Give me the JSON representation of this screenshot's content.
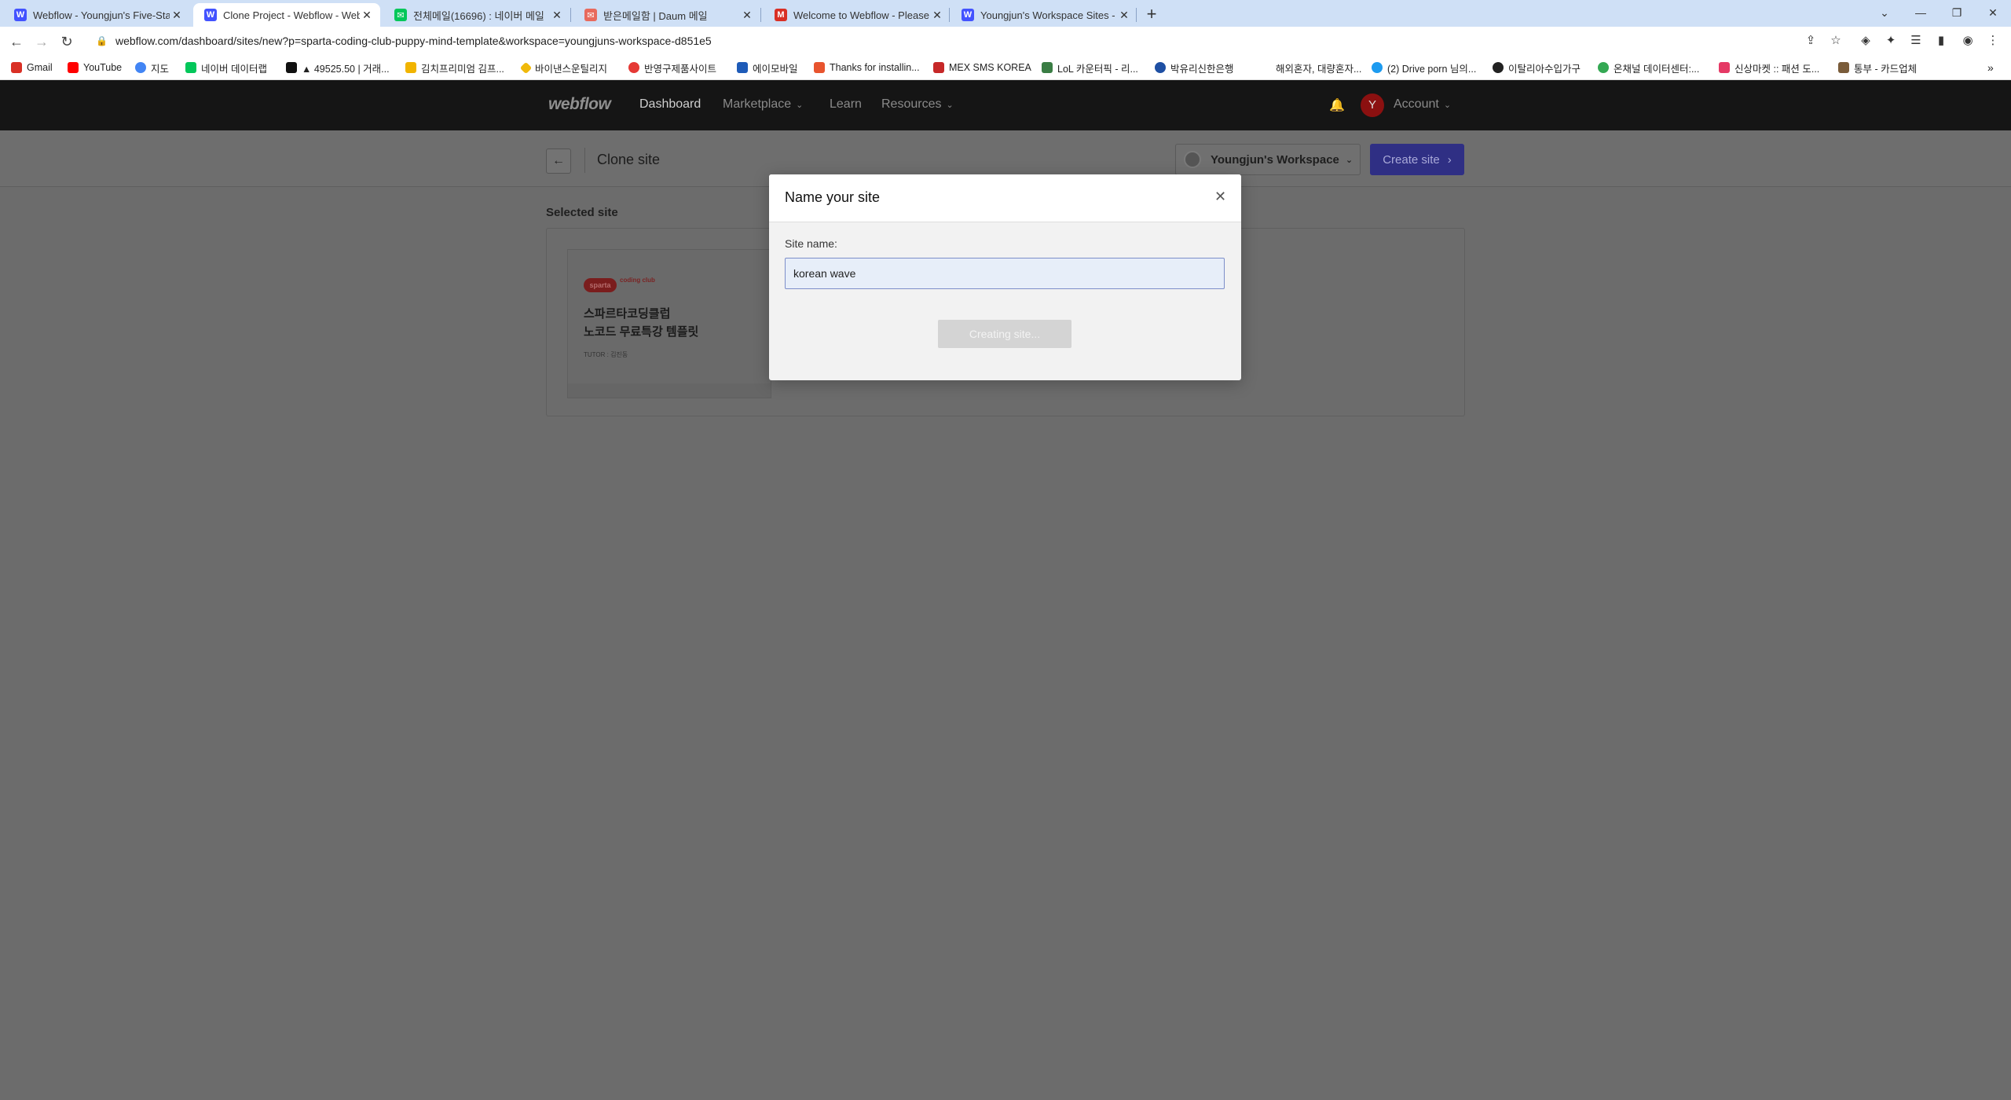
{
  "browser": {
    "tabs": [
      {
        "title": "Webflow - Youngjun's Five-Star",
        "icon": "webflow-icon",
        "color": "#4353ff"
      },
      {
        "title": "Clone Project - Webflow - Web",
        "icon": "webflow-icon",
        "color": "#4353ff"
      },
      {
        "title": "전체메일(16696) : 네이버 메일",
        "icon": "naver-mail-icon",
        "color": "#03c75a"
      },
      {
        "title": "받은메일함 | Daum 메일",
        "icon": "daum-mail-icon",
        "color": "#e86a5d"
      },
      {
        "title": "Welcome to Webflow - Please",
        "icon": "gmail-icon",
        "color": "#d93025"
      },
      {
        "title": "Youngjun's Workspace Sites - W",
        "icon": "webflow-icon",
        "color": "#4353ff"
      }
    ],
    "url": "webflow.com/dashboard/sites/new?p=sparta-coding-club-puppy-mind-template&workspace=youngjuns-workspace-d851e5",
    "bookmarks": [
      {
        "label": "Gmail",
        "color": "#d93025"
      },
      {
        "label": "YouTube",
        "color": "#ff0000"
      },
      {
        "label": "지도",
        "color": "#4285f4"
      },
      {
        "label": "네이버 데이터랩",
        "color": "#03c75a"
      },
      {
        "label": "▲ 49525.50 | 거래...",
        "color": "#111111"
      },
      {
        "label": "김치프리미엄 김프...",
        "color": "#f1b400"
      },
      {
        "label": "바이낸스운틸리지",
        "color": "#f0b90b"
      },
      {
        "label": "반영구제품사이트",
        "color": "#e53935"
      },
      {
        "label": "에이모바일",
        "color": "#1e5bb8"
      },
      {
        "label": "Thanks for installin...",
        "color": "#e8542e"
      },
      {
        "label": "MEX SMS KOREA",
        "color": "#c62828"
      },
      {
        "label": "LoL 카운터픽 - 리...",
        "color": "#3a7d44"
      },
      {
        "label": "박유리신한은행",
        "color": "#1e4fa3"
      },
      {
        "label": "해외혼자, 대량혼자...",
        "color": "#ffffff"
      },
      {
        "label": "(2) Drive porn 님의...",
        "color": "#1d9bf0"
      },
      {
        "label": "이탈리아수입가구",
        "color": "#222222"
      },
      {
        "label": "온채널 데이터센터:...",
        "color": "#34a853"
      },
      {
        "label": "신상마켓 :: 패션 도...",
        "color": "#e53965"
      },
      {
        "label": "통부 - 카드업체",
        "color": "#7a5c3a"
      }
    ]
  },
  "nav": {
    "logo": "webflow",
    "links": [
      "Dashboard",
      "Marketplace",
      "Learn",
      "Resources"
    ],
    "avatar": "Y",
    "account": "Account"
  },
  "subheader": {
    "title": "Clone site",
    "workspace": "Youngjun's Workspace",
    "create": "Create site"
  },
  "content": {
    "selected_label": "Selected site",
    "thumb_logo": "sparta",
    "thumb_logo2": "coding club",
    "thumb_title_1": "스파르타코딩클럽",
    "thumb_title_2": "노코드 무료특강 템플릿",
    "thumb_tutor": "TUTOR : 김진동"
  },
  "modal": {
    "title": "Name your site",
    "label": "Site name:",
    "value": "korean wave",
    "button": "Creating site..."
  }
}
